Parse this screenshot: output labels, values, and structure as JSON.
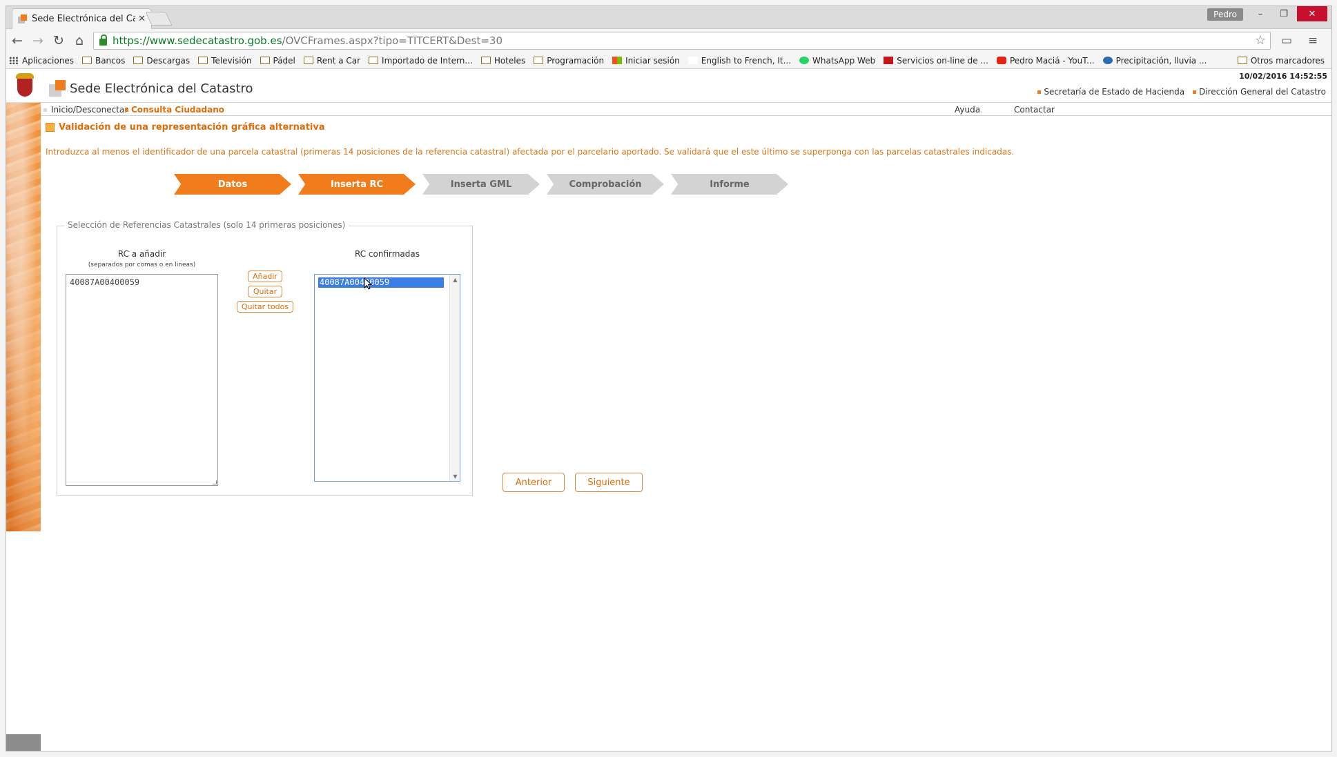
{
  "browser": {
    "tab_title": "Sede Electrónica del Catas",
    "tab_close": "✕",
    "profile": "Pedro",
    "window_controls": {
      "minimize": "–",
      "maximize": "❐",
      "close": "✕"
    },
    "nav": {
      "back": "←",
      "forward": "→",
      "reload": "↻",
      "home": "⌂"
    },
    "url_main": "https://www.sedecatastro.gob.es",
    "url_rest": "/OVCFrames.aspx?tipo=TITCERT&Dest=30",
    "star": "☆",
    "cast": "▭",
    "menu": "≡",
    "bookmarks": [
      {
        "label": "Aplicaciones",
        "icon": "apps-icon"
      },
      {
        "label": "Bancos",
        "icon": "folder-icon"
      },
      {
        "label": "Descargas",
        "icon": "folder-icon"
      },
      {
        "label": "Televisión",
        "icon": "folder-icon"
      },
      {
        "label": "Pádel",
        "icon": "folder-icon"
      },
      {
        "label": "Rent a Car",
        "icon": "folder-icon"
      },
      {
        "label": "Importado de Intern...",
        "icon": "folder-icon"
      },
      {
        "label": "Hoteles",
        "icon": "folder-icon"
      },
      {
        "label": "Programación",
        "icon": "folder-icon"
      },
      {
        "label": "Iniciar sesión",
        "icon": "microsoft-icon"
      },
      {
        "label": "English to French, It...",
        "icon": "wordreference-icon"
      },
      {
        "label": "WhatsApp Web",
        "icon": "whatsapp-icon"
      },
      {
        "label": "Servicios on-line de ...",
        "icon": "service-icon"
      },
      {
        "label": "Pedro Maciá - YouT...",
        "icon": "youtube-icon"
      },
      {
        "label": "Precipitación, lluvia ...",
        "icon": "weather-icon"
      }
    ],
    "other_bookmarks": "Otros marcadores"
  },
  "site": {
    "datetime": "10/02/2016 14:52:55",
    "title": "Sede Electrónica del Catastro",
    "head_links": [
      "Secretaría de Estado de Hacienda",
      "Dirección General del Catastro"
    ],
    "menu": {
      "inicio": "Inicio/Desconectar",
      "consulta": "Consulta Ciudadano",
      "ayuda": "Ayuda",
      "contactar": "Contactar"
    }
  },
  "main": {
    "heading": "Validación de una representación gráfica alternativa",
    "instructions": "Introduzca al menos el identificador de una parcela catastral (primeras 14 posiciones de la referencia catastral) afectada por el parcelario aportado. Se validará que el este último se superponga con las parcelas catastrales indicadas.",
    "steps": [
      {
        "label": "Datos",
        "state": "active"
      },
      {
        "label": "Inserta RC",
        "state": "active"
      },
      {
        "label": "Inserta GML",
        "state": "inactive"
      },
      {
        "label": "Comprobación",
        "state": "inactive"
      },
      {
        "label": "Informe",
        "state": "inactive"
      }
    ],
    "fieldset_legend": "Selección de Referencias Catastrales (solo 14 primeras posiciones)",
    "rc_add_title": "RC a añadir",
    "rc_add_subtitle": "(separados por comas o en lineas)",
    "rc_add_value": "40087A00400059",
    "buttons": {
      "add": "Añadir",
      "remove": "Quitar",
      "remove_all": "Quitar todos"
    },
    "rc_confirmed_title": "RC confirmadas",
    "rc_confirmed_items": [
      "40087A00400059"
    ],
    "scroll_up": "▲",
    "scroll_down": "▼",
    "prev_button": "Anterior",
    "next_button": "Siguiente"
  },
  "colors": {
    "accent": "#f07c1b",
    "accent_text": "#e06c0a",
    "step_inactive": "#d3d3d3",
    "selection": "#3b7fe6"
  }
}
